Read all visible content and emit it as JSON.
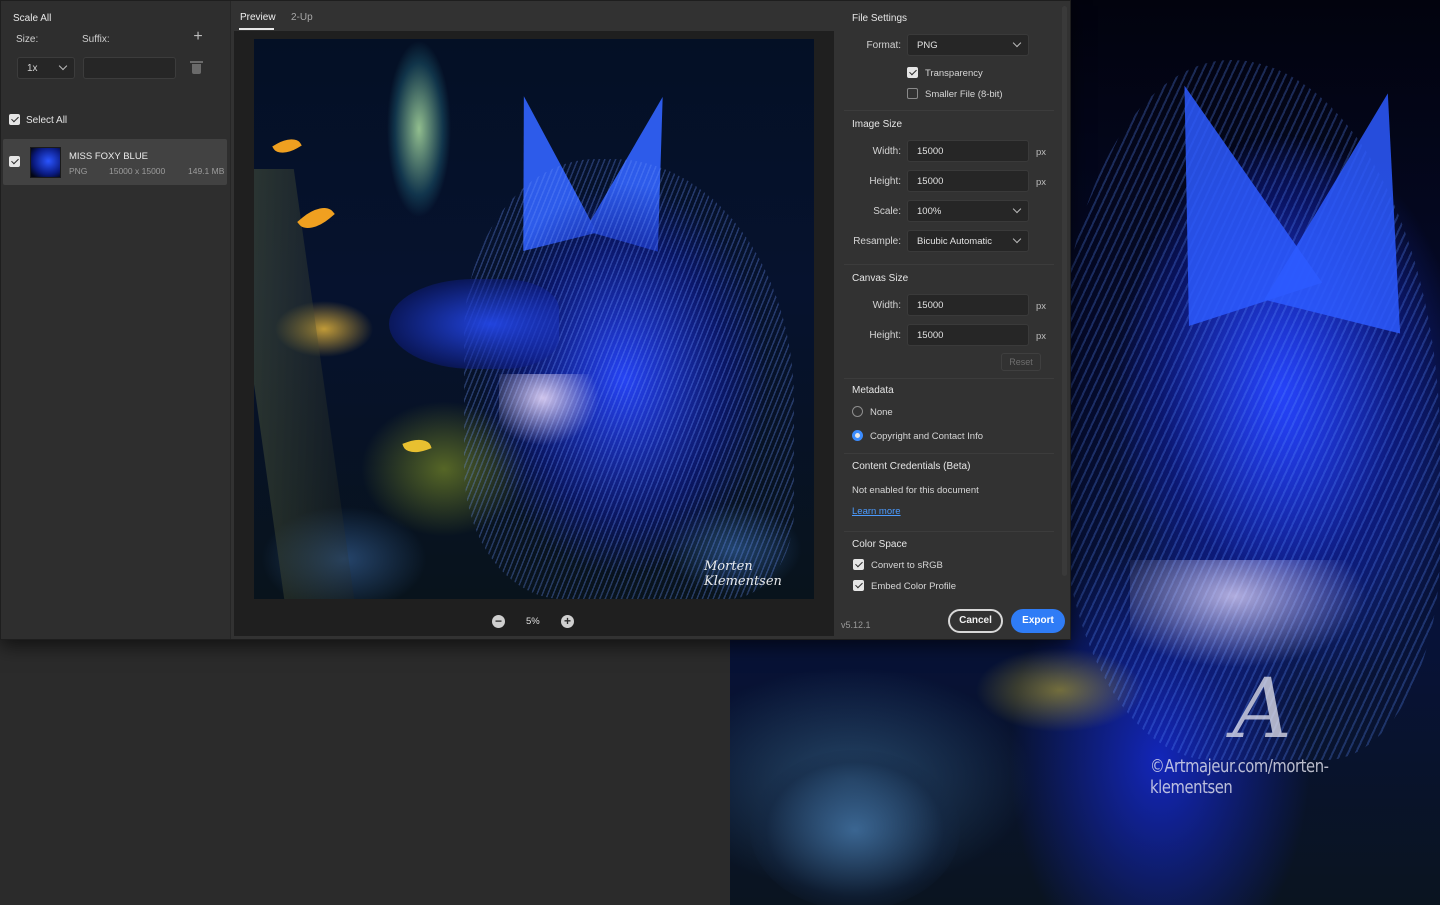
{
  "left": {
    "scale_all": "Scale All",
    "size_label": "Size:",
    "suffix_label": "Suffix:",
    "size_value": "1x",
    "suffix_value": "",
    "select_all": "Select All",
    "asset": {
      "name": "MISS FOXY BLUE",
      "format": "PNG",
      "dimensions": "15000 x 15000",
      "file_size": "149.1 MB"
    }
  },
  "tabs": [
    {
      "label": "Preview"
    },
    {
      "label": "2-Up"
    }
  ],
  "preview": {
    "signature": "Morten Klementsen",
    "zoom": "5%"
  },
  "settings": {
    "file_settings": {
      "title": "File Settings",
      "format_label": "Format:",
      "format_value": "PNG",
      "transparency": "Transparency",
      "smaller_file": "Smaller File (8-bit)"
    },
    "image_size": {
      "title": "Image Size",
      "width_label": "Width:",
      "width_value": "15000",
      "height_label": "Height:",
      "height_value": "15000",
      "scale_label": "Scale:",
      "scale_value": "100%",
      "resample_label": "Resample:",
      "resample_value": "Bicubic Automatic",
      "unit": "px"
    },
    "canvas_size": {
      "title": "Canvas Size",
      "width_label": "Width:",
      "width_value": "15000",
      "height_label": "Height:",
      "height_value": "15000",
      "unit": "px",
      "reset": "Reset"
    },
    "metadata": {
      "title": "Metadata",
      "none": "None",
      "copyright": "Copyright and Contact Info"
    },
    "content_credentials": {
      "title": "Content Credentials (Beta)",
      "status": "Not enabled for this document",
      "learn_more": "Learn more"
    },
    "color_space": {
      "title": "Color Space",
      "convert": "Convert to sRGB",
      "embed": "Embed Color Profile"
    }
  },
  "footer": {
    "version": "v5.12.1",
    "cancel": "Cancel",
    "export": "Export"
  },
  "watermark": {
    "logo": "A",
    "text": "©Artmajeur.com/morten-klementsen"
  },
  "colors": {
    "accent": "#2f7cf6",
    "link": "#4b9bff",
    "dialog_bg": "#323232",
    "app_bg": "#2b2b2b"
  }
}
